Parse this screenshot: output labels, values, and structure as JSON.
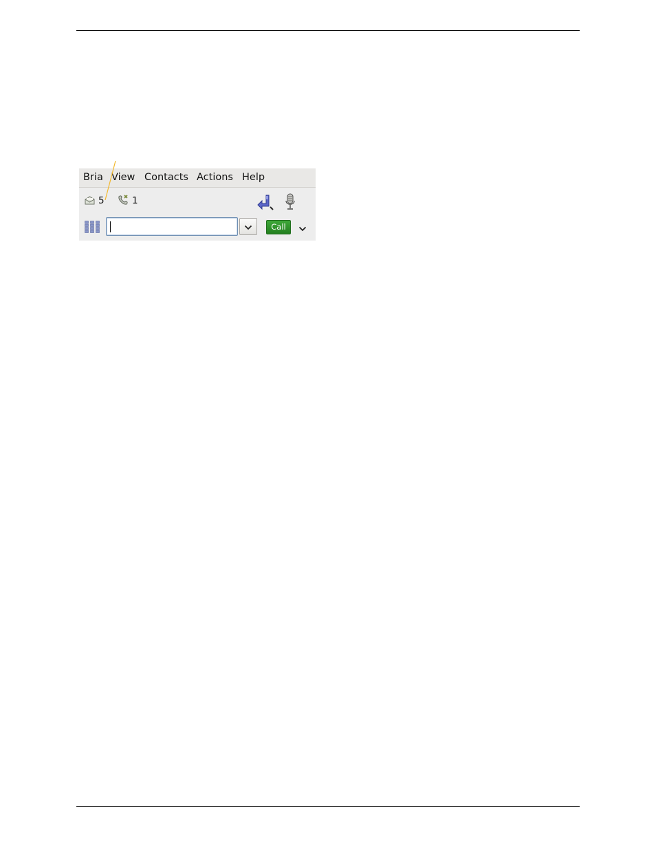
{
  "menu": {
    "items": [
      {
        "label": "Bria"
      },
      {
        "label": "View"
      },
      {
        "label": "Contacts"
      },
      {
        "label": "Actions"
      },
      {
        "label": "Help"
      }
    ]
  },
  "status": {
    "voicemail": {
      "count": "5",
      "icon": "voicemail-envelope-icon"
    },
    "missed_calls": {
      "count": "1",
      "icon": "missed-call-icon"
    }
  },
  "toolbar": {
    "transfer_icon": "transfer-arrow-icon",
    "microphone_icon": "microphone-icon"
  },
  "dialer": {
    "dialpad_icon": "dialpad-icon",
    "input_value": "",
    "call_label": "Call",
    "call_color": "#2e8f29"
  },
  "callout_color": "#f2b82e"
}
